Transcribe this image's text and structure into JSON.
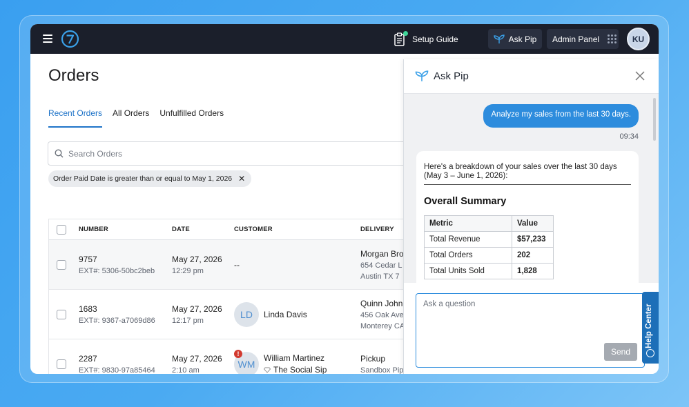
{
  "topbar": {
    "setup_guide": "Setup Guide",
    "ask_pip": "Ask Pip",
    "admin_panel": "Admin Panel",
    "user_initials": "KU"
  },
  "main": {
    "title": "Orders",
    "tabs": [
      "Recent Orders",
      "All Orders",
      "Unfulfilled Orders"
    ],
    "search_placeholder": "Search Orders",
    "filter_chip": "Order Paid Date is greater than or equal to May 1, 2026",
    "columns": [
      "NUMBER",
      "DATE",
      "CUSTOMER",
      "DELIVERY"
    ],
    "rows": [
      {
        "number": "9757",
        "ext": "EXT#: 5306-50bc2beb",
        "date": "May 27, 2026",
        "time": "12:29 pm",
        "customer": "--",
        "initials": "",
        "company": "",
        "delivery": "Morgan Bro",
        "addr1": "654 Cedar L",
        "addr2": "Austin TX 7"
      },
      {
        "number": "1683",
        "ext": "EXT#: 9367-a7069d86",
        "date": "May 27, 2026",
        "time": "12:17 pm",
        "customer": "Linda Davis",
        "initials": "LD",
        "company": "",
        "delivery": "Quinn John",
        "addr1": "456 Oak Ave",
        "addr2": "Monterey CA"
      },
      {
        "number": "2287",
        "ext": "EXT#: 9830-97a85464",
        "date": "May 27, 2026",
        "time": "2:10 am",
        "customer": "William Martinez",
        "initials": "WM",
        "company": "The Social Sip",
        "delivery": "Pickup",
        "addr1": "Sandbox Pip",
        "addr2": ""
      }
    ]
  },
  "chat": {
    "title": "Ask Pip",
    "user_message": "Analyze my sales from the last 30 days.",
    "timestamp": "09:34",
    "intro": "Here's a breakdown of your sales over the last 30 days (May 3 – June 1, 2026):",
    "summary_heading": "Overall Summary",
    "table_headers": [
      "Metric",
      "Value"
    ],
    "table_rows": [
      [
        "Total Revenue",
        "$57,233"
      ],
      [
        "Total Orders",
        "202"
      ],
      [
        "Total Units Sold",
        "1,828"
      ]
    ],
    "input_placeholder": "Ask a question",
    "send_label": "Send"
  },
  "help_center": "Help Center",
  "colors": {
    "accent": "#1e73c8",
    "topbar": "#1b1f2b",
    "user_bubble": "#2d8cdd",
    "alert": "#d23a2f"
  }
}
